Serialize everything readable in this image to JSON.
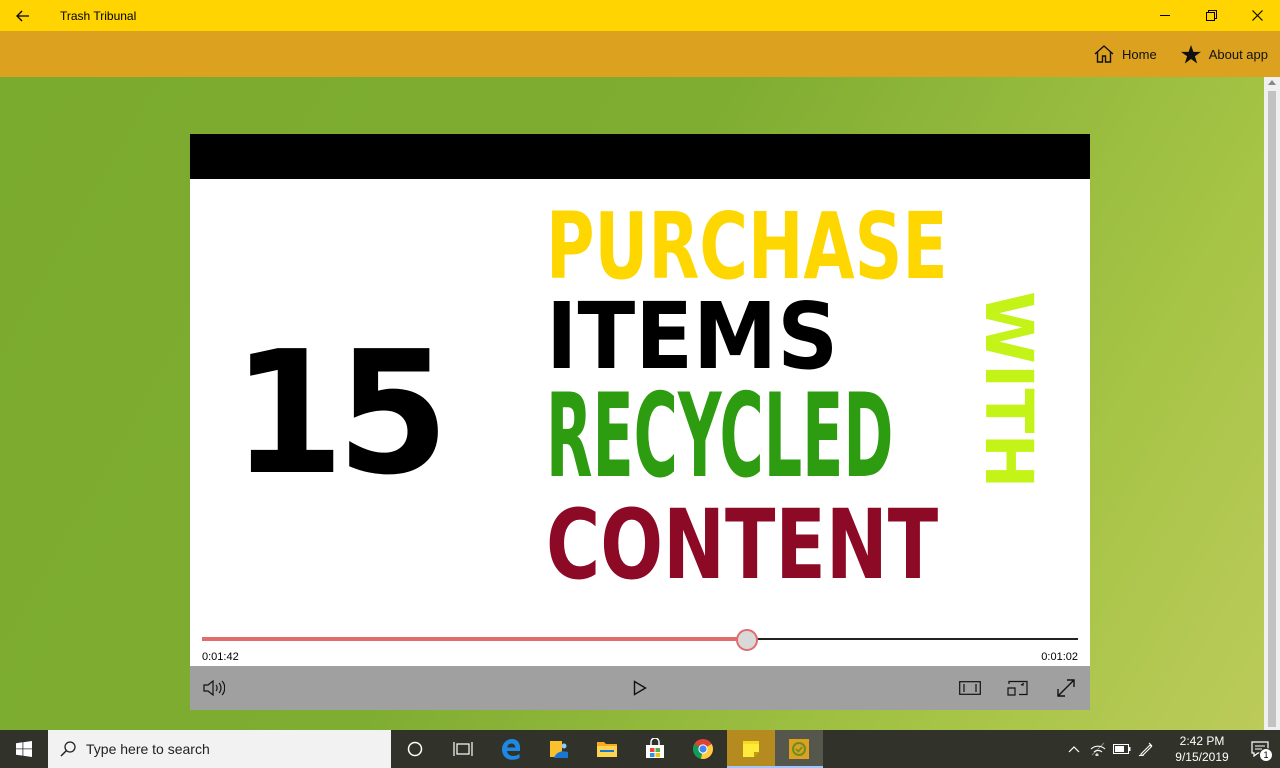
{
  "window": {
    "title": "Trash Tribunal"
  },
  "nav": {
    "items": [
      {
        "label": "Home",
        "icon": "home-icon"
      },
      {
        "label": "About app",
        "icon": "star-icon"
      }
    ]
  },
  "video": {
    "frame_text": {
      "number": "15",
      "line1": "PURCHASE",
      "line2": "ITEMS",
      "line3": "RECYCLED",
      "line4": "CONTENT",
      "vertical": "WITH"
    },
    "colors": {
      "purchase": "#ffd700",
      "items": "#000000",
      "recycled": "#2e9c10",
      "content": "#8c0a25",
      "with": "#c3f317",
      "progress": "#e06c6c"
    },
    "elapsed": "0:01:42",
    "remaining": "0:01:02",
    "progress_fraction": 0.622,
    "controls": [
      "volume-icon",
      "play-icon",
      "aspect-ratio-icon",
      "cast-to-device-icon",
      "fullscreen-icon"
    ]
  },
  "taskbar": {
    "search_placeholder": "Type here to search",
    "apps": [
      "cortana-icon",
      "task-view-icon",
      "edge-icon",
      "photos-icon",
      "file-explorer-icon",
      "store-icon",
      "chrome-icon",
      "sticky-notes-icon",
      "trash-tribunal-icon"
    ],
    "time": "2:42 PM",
    "date": "9/15/2019",
    "notification_count": "1"
  }
}
